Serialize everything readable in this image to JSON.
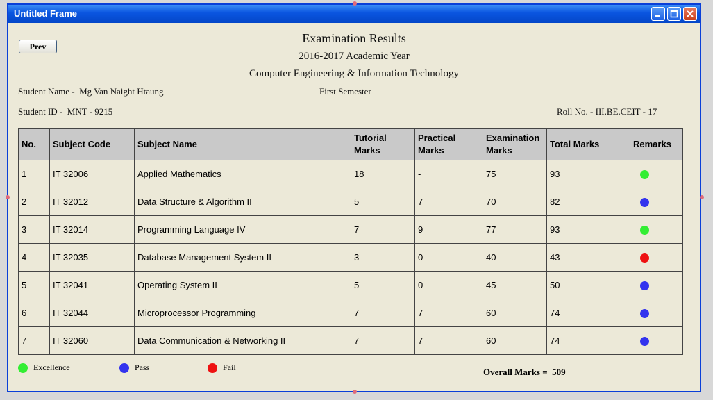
{
  "window": {
    "title": "Untitled Frame"
  },
  "prev_label": "Prev",
  "header": {
    "title": "Examination Results",
    "year": "2016-2017 Academic Year",
    "department": "Computer Engineering & Information Technology"
  },
  "student": {
    "name_label": "Student Name -",
    "name": "Mg Van Naight Htaung",
    "semester": "First Semester",
    "id_label": "Student ID -",
    "id": "MNT - 9215",
    "roll_label": "Roll No. -",
    "roll": "III.BE.CEIT - 17"
  },
  "table": {
    "headers": [
      "No.",
      "Subject Code",
      "Subject Name",
      "Tutorial Marks",
      "Practical Marks",
      "Examination Marks",
      "Total Marks",
      "Remarks"
    ],
    "rows": [
      {
        "no": "1",
        "code": "IT 32006",
        "name": "Applied Mathematics",
        "tutorial": "18",
        "practical": "-",
        "exam": "75",
        "total": "93",
        "remark": "excellence"
      },
      {
        "no": "2",
        "code": "IT 32012",
        "name": "Data Structure & Algorithm II",
        "tutorial": "5",
        "practical": "7",
        "exam": "70",
        "total": "82",
        "remark": "pass"
      },
      {
        "no": "3",
        "code": "IT 32014",
        "name": "Programming Language IV",
        "tutorial": "7",
        "practical": "9",
        "exam": "77",
        "total": "93",
        "remark": "excellence"
      },
      {
        "no": "4",
        "code": "IT 32035",
        "name": "Database Management System II",
        "tutorial": "3",
        "practical": "0",
        "exam": "40",
        "total": "43",
        "remark": "fail"
      },
      {
        "no": "5",
        "code": "IT 32041",
        "name": "Operating System II",
        "tutorial": "5",
        "practical": "0",
        "exam": "45",
        "total": "50",
        "remark": "pass"
      },
      {
        "no": "6",
        "code": "IT 32044",
        "name": "Microprocessor Programming",
        "tutorial": "7",
        "practical": "7",
        "exam": "60",
        "total": "74",
        "remark": "pass"
      },
      {
        "no": "7",
        "code": "IT 32060",
        "name": "Data Communication & Networking II",
        "tutorial": "7",
        "practical": "7",
        "exam": "60",
        "total": "74",
        "remark": "pass"
      }
    ]
  },
  "legend": [
    {
      "key": "excellence",
      "label": "Excellence",
      "color": "#33ee33"
    },
    {
      "key": "pass",
      "label": "Pass",
      "color": "#3333ee"
    },
    {
      "key": "fail",
      "label": "Fail",
      "color": "#ee1111"
    }
  ],
  "overall": {
    "label": "Overall Marks  =",
    "value": "509"
  }
}
